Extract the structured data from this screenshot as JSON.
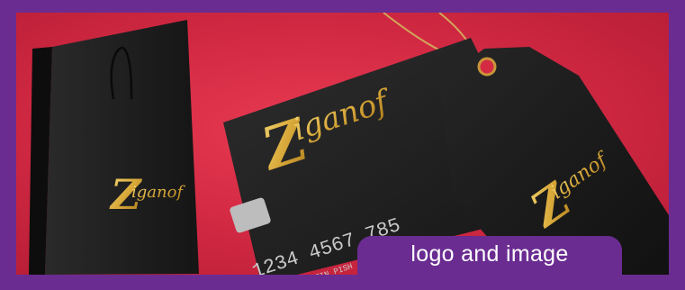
{
  "brand": {
    "logo_initial": "Z",
    "logo_rest": "iganof"
  },
  "card": {
    "number": "1234 4567 785",
    "holder": "ANDREW MARTIN PISH"
  },
  "caption": {
    "text": "logo and image"
  },
  "colors": {
    "frame": "#6a2c91",
    "background": "#d42a44",
    "gold": "#d9a93a",
    "black_items": "#1b1b1b"
  }
}
